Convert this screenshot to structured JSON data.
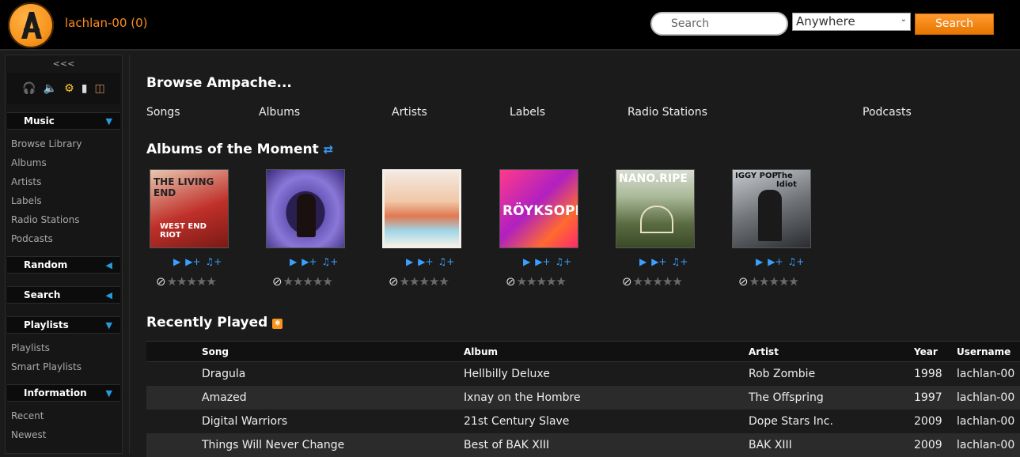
{
  "header": {
    "user": "lachlan-00 (0)",
    "search_placeholder": "Search",
    "scope": "Anywhere",
    "search_button": "Search"
  },
  "sidebar": {
    "collapse": "<<<",
    "sections": [
      {
        "title": "Music",
        "items": [
          "Browse Library",
          "Albums",
          "Artists",
          "Labels",
          "Radio Stations",
          "Podcasts"
        ]
      },
      {
        "title": "Random",
        "items": []
      },
      {
        "title": "Search",
        "items": []
      },
      {
        "title": "Playlists",
        "items": [
          "Playlists",
          "Smart Playlists"
        ]
      },
      {
        "title": "Information",
        "items": [
          "Recent",
          "Newest"
        ]
      }
    ]
  },
  "main": {
    "browse_title": "Browse Ampache...",
    "browse_links": [
      "Songs",
      "Albums",
      "Artists",
      "Labels",
      "Radio Stations",
      "Podcasts"
    ],
    "albums_title": "Albums of the Moment",
    "albums": [
      {
        "cover_text": "THE LIVING END",
        "cover_sub": "WEST END RIOT"
      },
      {
        "cover_text": "",
        "cover_sub": ""
      },
      {
        "cover_text": "",
        "cover_sub": ""
      },
      {
        "cover_text": "RÖYKSOPP",
        "cover_sub": ""
      },
      {
        "cover_text": "NANO.RIPE",
        "cover_sub": ""
      },
      {
        "cover_text": "IGGY POP",
        "cover_sub": "The Idiot"
      }
    ],
    "recent_title": "Recently Played",
    "table": {
      "columns": [
        "Song",
        "Album",
        "Artist",
        "Year",
        "Username"
      ],
      "rows": [
        [
          "Dragula",
          "Hellbilly Deluxe",
          "Rob Zombie",
          "1998",
          "lachlan-00"
        ],
        [
          "Amazed",
          "Ixnay on the Hombre",
          "The Offspring",
          "1997",
          "lachlan-00"
        ],
        [
          "Digital Warriors",
          "21st Century Slave",
          "Dope Stars Inc.",
          "2009",
          "lachlan-00"
        ],
        [
          "Things Will Never Change",
          "Best of BAK XIII",
          "BAK XIII",
          "2009",
          "lachlan-00"
        ]
      ]
    }
  }
}
